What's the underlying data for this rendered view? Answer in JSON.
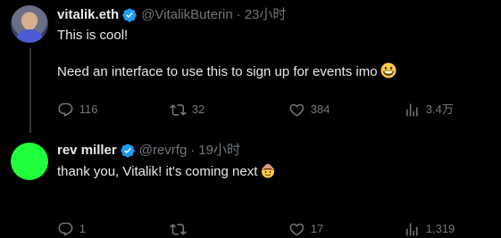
{
  "tweets": [
    {
      "name": "vitalik.eth",
      "handle": "@VitalikButerin",
      "separator": "·",
      "time": "23小时",
      "text_line_1": "This is cool!",
      "text_line_2": "Need an interface to use this to sign up for events imo",
      "emoji": "grinning-face-emoji",
      "actions": {
        "replies": "116",
        "retweets": "32",
        "likes": "384",
        "views": "3.4万"
      }
    },
    {
      "name": "rev miller",
      "handle": "@revrfg",
      "separator": "·",
      "time": "19小时",
      "text_line_1": "thank you, Vitalik! it's coming next",
      "emoji": "cowboy-hat-face-emoji",
      "actions": {
        "replies": "1",
        "retweets": "",
        "likes": "17",
        "views": "1,319"
      }
    }
  ],
  "colors": {
    "background": "#000000",
    "text_primary": "#e7e9ea",
    "text_secondary": "#71767b",
    "verified_blue": "#1d9bf0",
    "thread_line": "#333639",
    "rev_avatar": "#20ff3b"
  }
}
